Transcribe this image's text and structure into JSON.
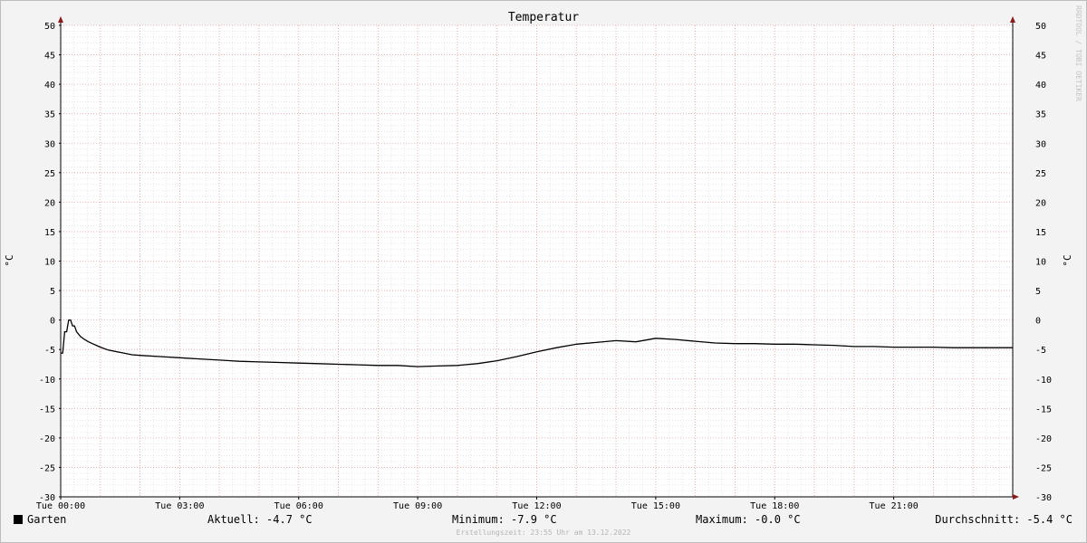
{
  "chart_data": {
    "type": "line",
    "title": "Temperatur",
    "ylabel": "°C",
    "ylim": [
      -30,
      50
    ],
    "y_ticks": [
      50,
      45,
      40,
      35,
      30,
      25,
      20,
      15,
      10,
      5,
      0,
      -5,
      -10,
      -15,
      -20,
      -25,
      -30
    ],
    "xlim": [
      0,
      24
    ],
    "x_tick_values": [
      0,
      3,
      6,
      9,
      12,
      15,
      18,
      21
    ],
    "x_tick_labels": [
      "Tue 00:00",
      "Tue 03:00",
      "Tue 06:00",
      "Tue 09:00",
      "Tue 12:00",
      "Tue 15:00",
      "Tue 18:00",
      "Tue 21:00"
    ],
    "grid": true,
    "series": [
      {
        "name": "Garten",
        "color": "#000000",
        "x": [
          0,
          0.05,
          0.1,
          0.15,
          0.2,
          0.25,
          0.3,
          0.35,
          0.4,
          0.5,
          0.6,
          0.7,
          0.8,
          0.9,
          1.0,
          1.2,
          1.5,
          1.8,
          2.0,
          2.5,
          3.0,
          3.5,
          4.0,
          4.5,
          5.0,
          5.5,
          6.0,
          6.5,
          7.0,
          7.5,
          8.0,
          8.5,
          9.0,
          9.5,
          10.0,
          10.5,
          11.0,
          11.5,
          12.0,
          12.5,
          13.0,
          13.5,
          14.0,
          14.5,
          15.0,
          15.5,
          16.0,
          16.5,
          17.0,
          17.5,
          18.0,
          18.5,
          19.0,
          19.5,
          20.0,
          20.5,
          21.0,
          21.5,
          22.0,
          22.5,
          23.0,
          23.5,
          24.0
        ],
        "values": [
          -5.6,
          -5.6,
          -2.0,
          -2.0,
          0.0,
          0.0,
          -1.0,
          -1.0,
          -2.0,
          -2.8,
          -3.3,
          -3.7,
          -4.0,
          -4.3,
          -4.6,
          -5.1,
          -5.5,
          -5.9,
          -6.0,
          -6.2,
          -6.4,
          -6.6,
          -6.8,
          -7.0,
          -7.1,
          -7.2,
          -7.3,
          -7.4,
          -7.5,
          -7.6,
          -7.7,
          -7.7,
          -7.9,
          -7.8,
          -7.7,
          -7.4,
          -6.9,
          -6.2,
          -5.4,
          -4.7,
          -4.1,
          -3.8,
          -3.5,
          -3.7,
          -3.1,
          -3.3,
          -3.6,
          -3.9,
          -4.0,
          -4.0,
          -4.1,
          -4.1,
          -4.2,
          -4.3,
          -4.5,
          -4.5,
          -4.6,
          -4.6,
          -4.6,
          -4.7,
          -4.7,
          -4.7,
          -4.7
        ]
      }
    ]
  },
  "legend": {
    "series_name": "Garten",
    "current": "Aktuell: -4.7 °C",
    "minimum": "Minimum: -7.9 °C",
    "maximum": "Maximum: -0.0 °C",
    "average": "Durchschnitt: -5.4 °C"
  },
  "footer": "Erstellungszeit: 23:55 Uhr am 13.12.2022",
  "watermark": "RRDTOOL / TOBI OETIKER"
}
